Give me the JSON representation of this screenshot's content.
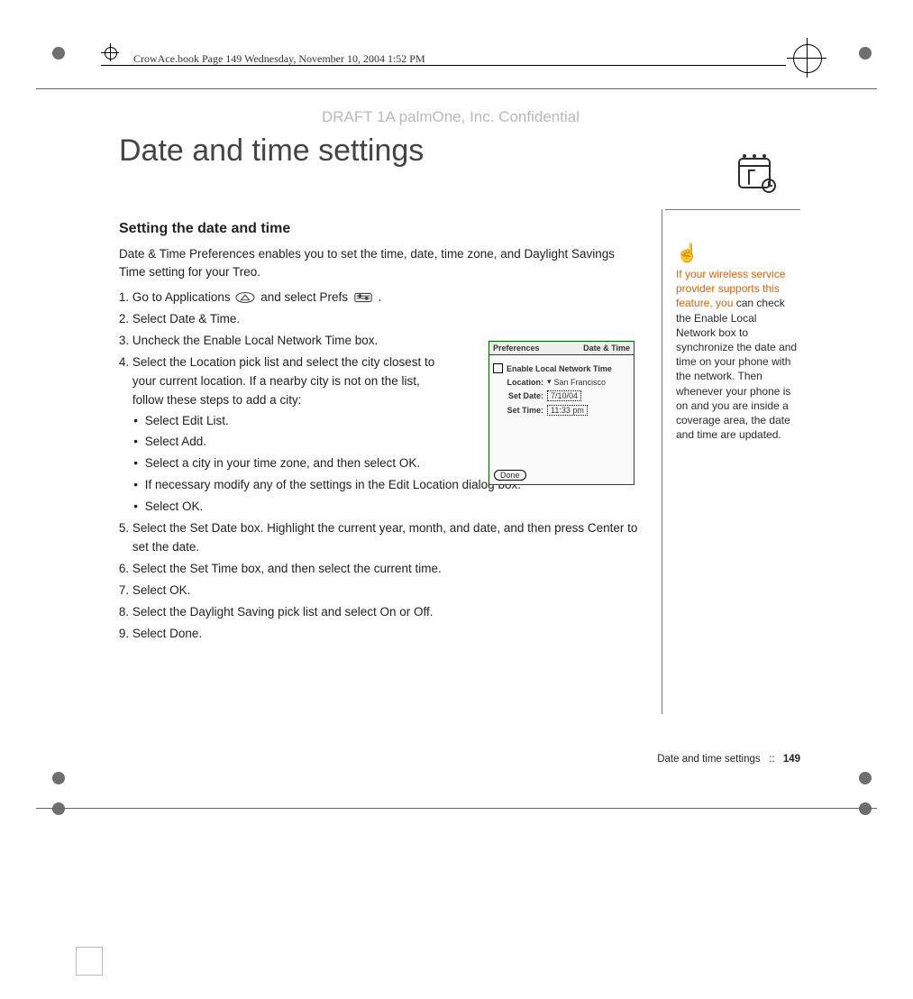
{
  "header": {
    "file_info": "CrowAce.book  Page 149  Wednesday, November 10, 2004  1:52 PM"
  },
  "watermark": "DRAFT 1A  palmOne, Inc.   Confidential",
  "title": "Date and time settings",
  "section_heading": "Setting the date and time",
  "intro": "Date & Time Preferences enables you to set the time, date, time zone, and Daylight Savings Time setting for your Treo.",
  "steps": {
    "s1a": "Go to Applications ",
    "s1b": " and select Prefs ",
    "s1c": ".",
    "s2": "Select Date & Time.",
    "s3": "Uncheck the Enable Local Network Time box.",
    "s4": "Select the Location pick list and select the city closest to your current location. If a nearby city is not on the list, follow these steps to add a city:",
    "s4b1": "Select Edit List.",
    "s4b2": "Select Add.",
    "s4b3": "Select a city in your time zone, and then select OK.",
    "s4b4": "If necessary modify any of the settings in the Edit Location dialog box.",
    "s4b5": "Select OK.",
    "s5": "Select the Set Date box. Highlight the current year, month, and date, and then press Center to set the date.",
    "s6": "Select the Set Time box, and then select the current time.",
    "s7": "Select OK.",
    "s8": "Select the Daylight Saving pick list and select On or Off.",
    "s9": "Select Done."
  },
  "screenshot": {
    "title_left": "Preferences",
    "title_right": "Date & Time",
    "checkbox_label": "Enable Local Network Time",
    "location_label": "Location:",
    "location_value": "San Francisco",
    "date_label": "Set Date:",
    "date_value": "7/10/04",
    "time_label": "Set Time:",
    "time_value": "11:33 pm",
    "done": "Done"
  },
  "tip": {
    "highlight": "If your wireless service provider supports this feature, you",
    "rest": " can check the Enable Local Network box to synchronize the date and time on your phone with the network. Then whenever your phone is on and you are inside a coverage area, the date and time are updated."
  },
  "footer": {
    "section": "Date and time settings",
    "separator": "::",
    "page": "149"
  }
}
